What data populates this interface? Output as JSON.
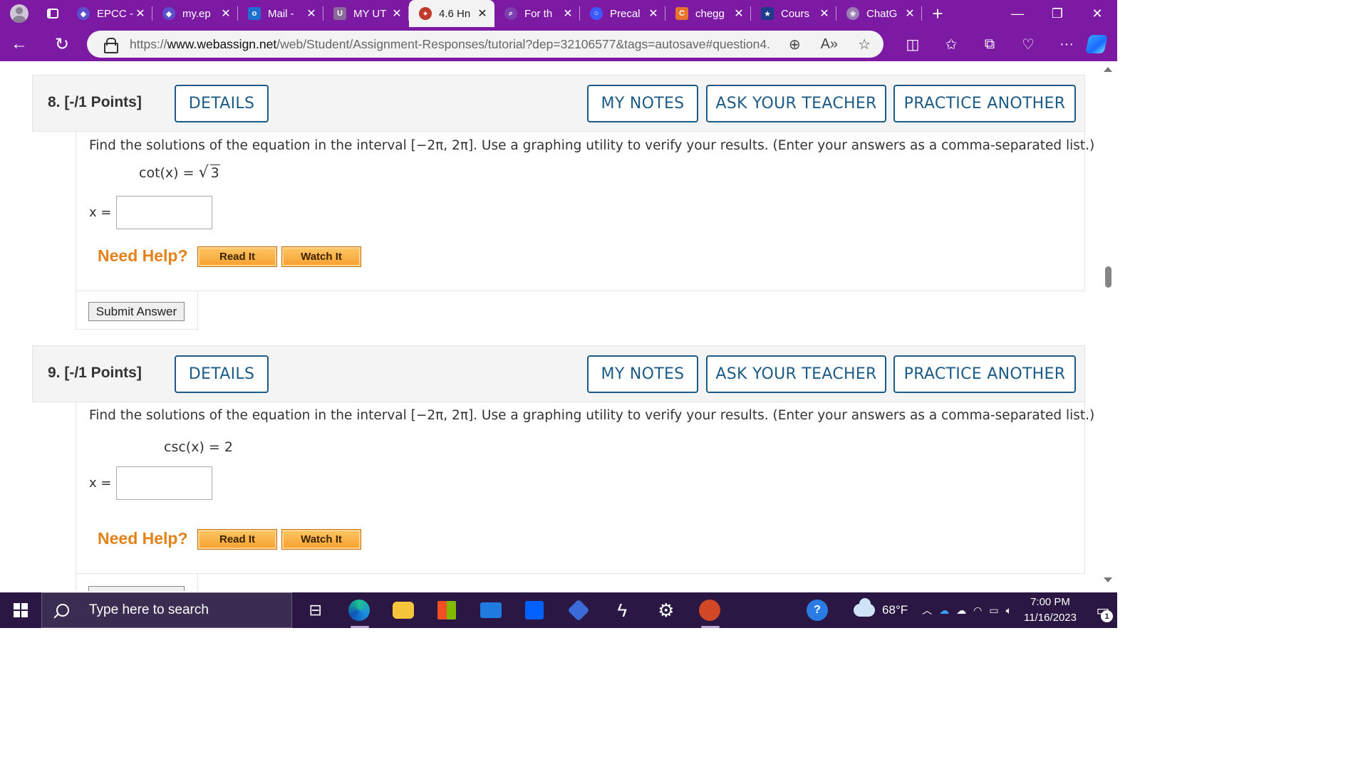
{
  "browser": {
    "tabs": [
      {
        "title": "EPCC -",
        "favicon_color": "#5a4fcf",
        "active": false
      },
      {
        "title": "my.ep",
        "favicon_color": "#5a4fcf",
        "active": false
      },
      {
        "title": "Mail -",
        "favicon_color": "#1f6fd1",
        "active": false
      },
      {
        "title": "MY UT",
        "favicon_color": "#8a6a9a",
        "active": false
      },
      {
        "title": "4.6 Hn",
        "favicon_color": "#c0392b",
        "active": true
      },
      {
        "title": "For th",
        "favicon_color": "#7d3fb0",
        "active": false
      },
      {
        "title": "Precal",
        "favicon_color": "#3d5afe",
        "active": false
      },
      {
        "title": "chegg",
        "favicon_color": "#e8742c",
        "active": false
      },
      {
        "title": "Cours",
        "favicon_color": "#1e3a8a",
        "active": false
      },
      {
        "title": "ChatG",
        "favicon_color": "#9a7db5",
        "active": false
      }
    ],
    "url_domain": "www.webassign.net",
    "url_scheme": "https://",
    "url_path": "/web/Student/Assignment-Responses/tutorial?dep=32106577&tags=autosave#question4..."
  },
  "questions": [
    {
      "number_label": "8.  [-/1 Points]",
      "details": "DETAILS",
      "my_notes": "MY NOTES",
      "ask_teacher": "ASK YOUR TEACHER",
      "practice": "PRACTICE ANOTHER",
      "prompt": "Find the solutions of the equation in the interval [−2π, 2π]. Use a graphing utility to verify your results. (Enter your answers as a comma-separated list.)",
      "eq_lhs": "cot(x) = ",
      "eq_rad": "3",
      "x_label": "x =",
      "answer_value": "",
      "need_help": "Need Help?",
      "read_it": "Read It",
      "watch_it": "Watch It",
      "submit": "Submit Answer"
    },
    {
      "number_label": "9.  [-/1 Points]",
      "details": "DETAILS",
      "my_notes": "MY NOTES",
      "ask_teacher": "ASK YOUR TEACHER",
      "practice": "PRACTICE ANOTHER",
      "prompt": "Find the solutions of the equation in the interval [−2π, 2π]. Use a graphing utility to verify your results. (Enter your answers as a comma-separated list.)",
      "equation": "csc(x)  =  2",
      "x_label": "x =",
      "answer_value": "",
      "need_help": "Need Help?",
      "read_it": "Read It",
      "watch_it": "Watch It"
    }
  ],
  "taskbar": {
    "search_placeholder": "Type here to search",
    "temperature": "68°F",
    "time": "7:00 PM",
    "date": "11/16/2023",
    "notification_count": "1"
  }
}
